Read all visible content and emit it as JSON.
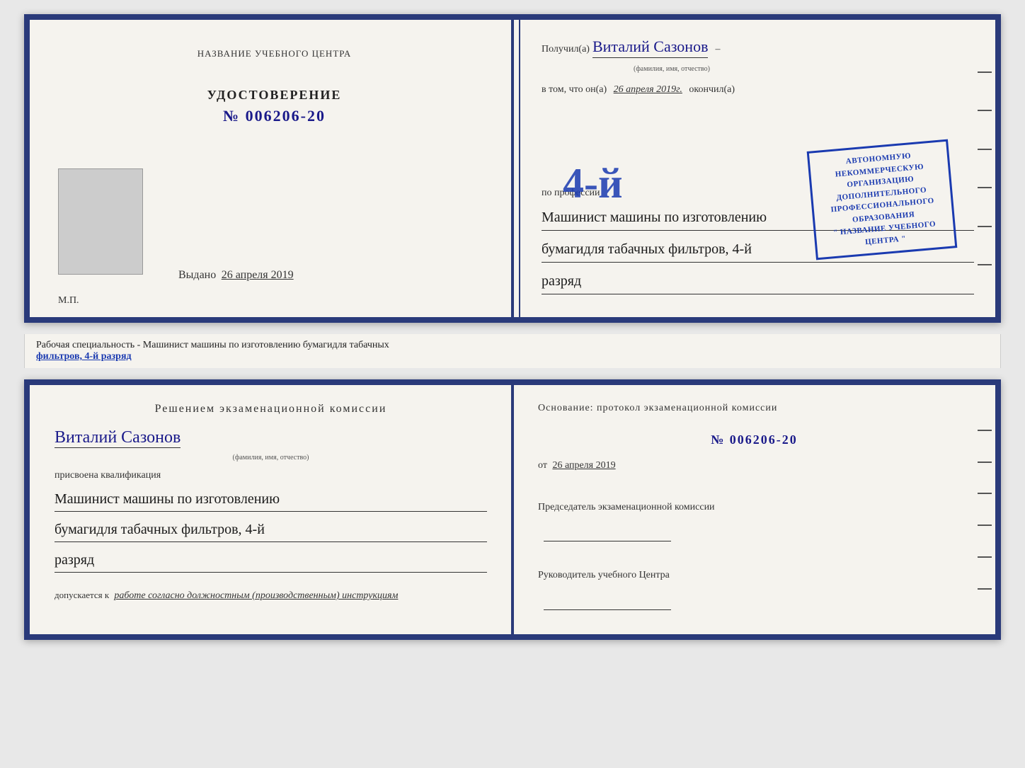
{
  "top_left_page": {
    "center_title": "НАЗВАНИЕ УЧЕБНОГО ЦЕНТРА",
    "cert_label": "УДОСТОВЕРЕНИЕ",
    "cert_number": "№ 006206-20",
    "issued_prefix": "Выдано",
    "issued_date": "26 апреля 2019",
    "mp_label": "М.П."
  },
  "top_right_page": {
    "recipient_prefix": "Получил(а)",
    "recipient_name": "Виталий Сазонов",
    "recipient_subtext": "(фамилия, имя, отчество)",
    "in_that_prefix": "в том, что он(а)",
    "date_value": "26 апреля 2019г.",
    "finished_label": "окончил(а)",
    "big_number": "4-й",
    "org_line1": "АВТОНОМНУЮ НЕКОММЕРЧЕСКУЮ ОРГАНИЗАЦИЮ",
    "org_line2": "ДОПОЛНИТЕЛЬНОГО ПРОФЕССИОНАЛЬНОГО ОБРАЗОВАНИЯ",
    "org_line3": "\" НАЗВАНИЕ УЧЕБНОГО ЦЕНТРА \"",
    "profession_prefix": "по профессии",
    "profession_line1": "Машинист машины по изготовлению",
    "profession_line2": "бумагидля табачных фильтров, 4-й",
    "profession_line3": "разряд"
  },
  "middle_strip": {
    "text_prefix": "Рабочая специальность - Машинист машины по изготовлению бумагидля табачных",
    "text_underline": "фильтров, 4-й разряд"
  },
  "bottom_left_page": {
    "commission_title": "Решением экзаменационной комиссии",
    "person_name": "Виталий Сазонов",
    "person_subtext": "(фамилия, имя, отчество)",
    "assigned_label": "присвоена квалификация",
    "qual_line1": "Машинист машины по изготовлению",
    "qual_line2": "бумагидля табачных фильтров, 4-й",
    "qual_line3": "разряд",
    "allowed_prefix": "допускается к",
    "allowed_value": "работе согласно должностным (производственным) инструкциям"
  },
  "bottom_right_page": {
    "basis_title": "Основание: протокол экзаменационной комиссии",
    "protocol_number": "№ 006206-20",
    "date_prefix": "от",
    "date_value": "26 апреля 2019",
    "commission_chair_label": "Председатель экзаменационной комиссии",
    "training_center_head": "Руководитель учебного Центра"
  },
  "accent_color": "#1a3ab0",
  "text_color": "#222222"
}
